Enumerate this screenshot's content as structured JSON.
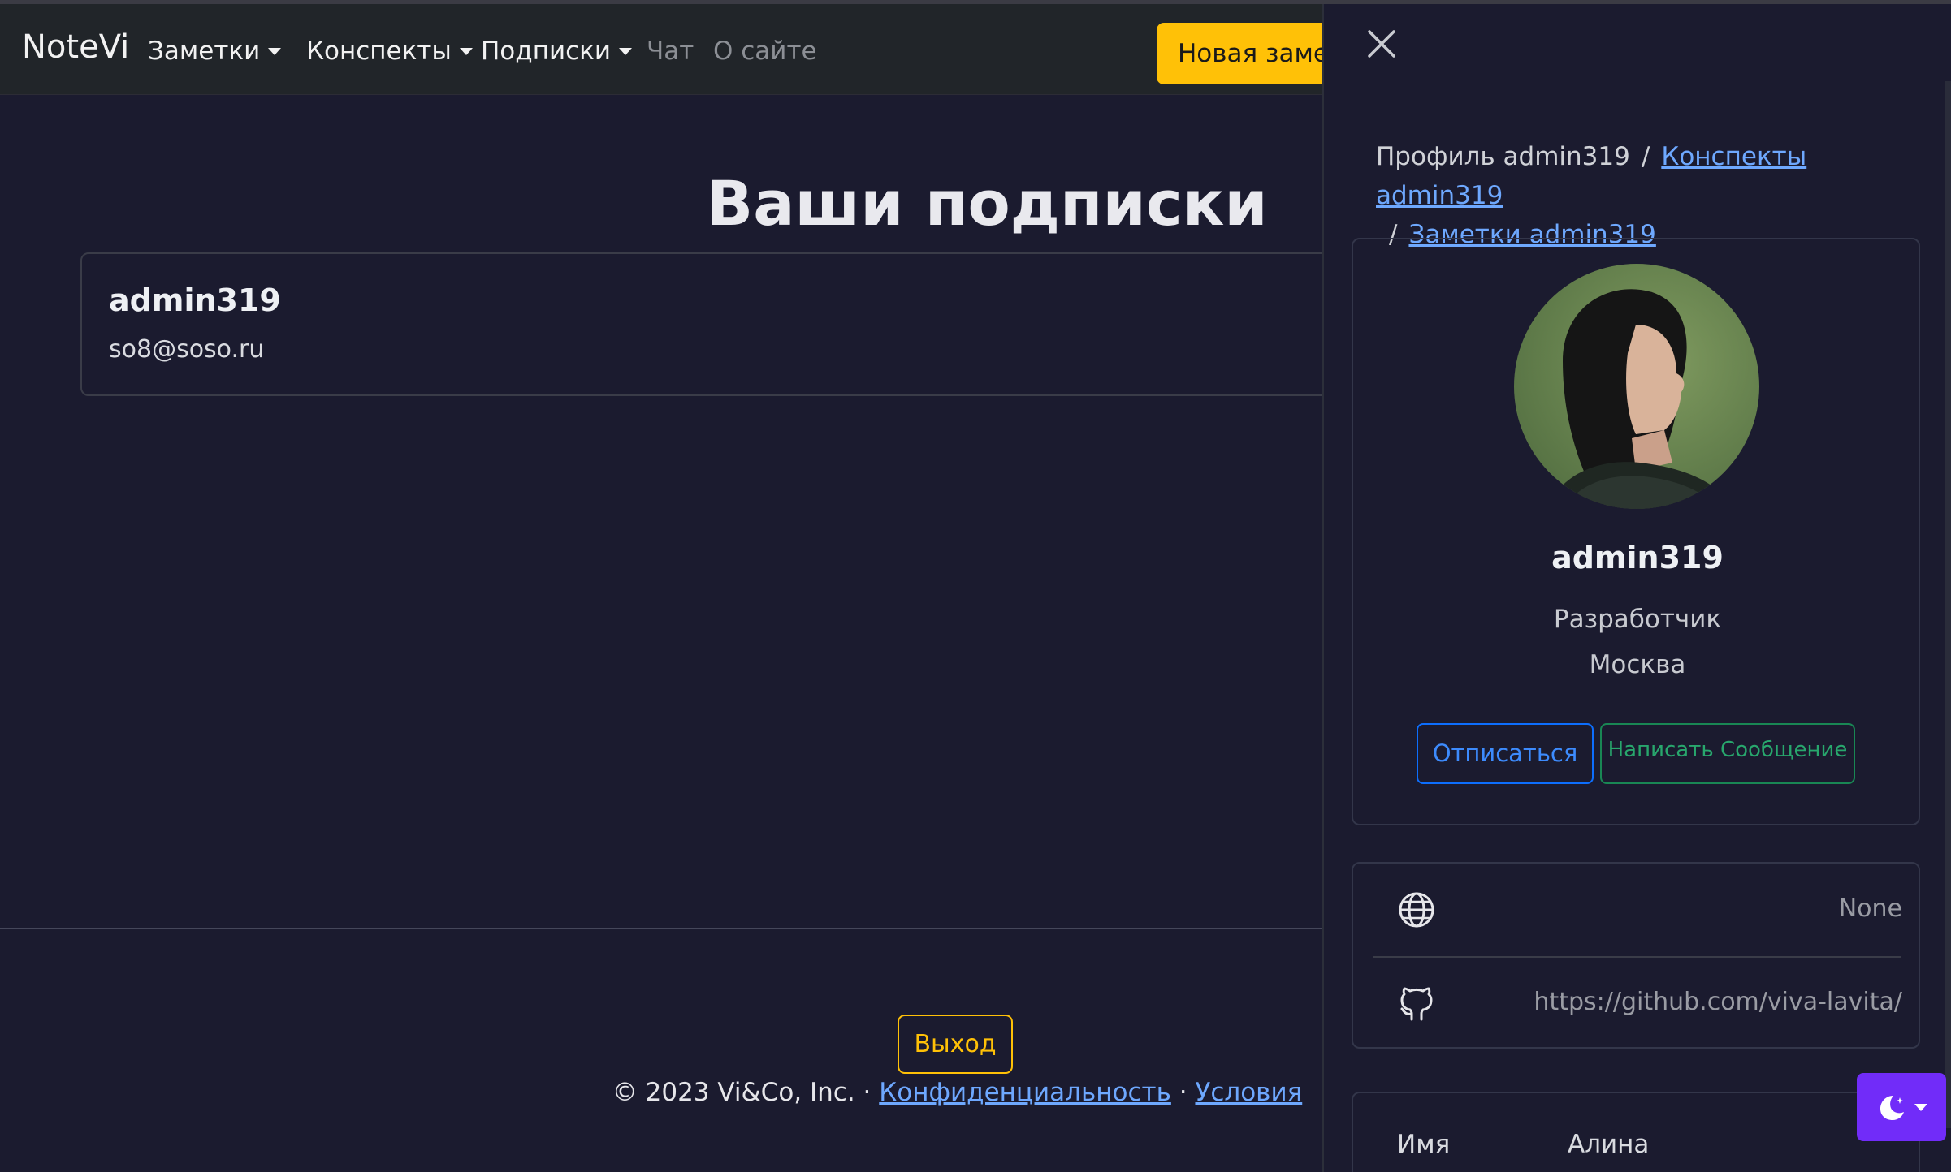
{
  "navbar": {
    "brand": "NoteVi",
    "items": [
      {
        "label": "Заметки",
        "dropdown": true
      },
      {
        "label": "Конспекты",
        "dropdown": true
      },
      {
        "label": "Подписки",
        "dropdown": true
      },
      {
        "label": "Чат",
        "dropdown": false
      },
      {
        "label": "О сайте",
        "dropdown": false
      }
    ],
    "new_note_label": "Новая заметка"
  },
  "main": {
    "title": "Ваши подписки",
    "subscriptions": [
      {
        "name": "admin319",
        "email": "so8@soso.ru"
      }
    ]
  },
  "footer": {
    "logout_label": "Выход",
    "copyright": "© 2023 Vi&Co, Inc. ·",
    "privacy_label": "Конфиденциальность",
    "dot": "·",
    "terms_label": "Условия"
  },
  "profile": {
    "breadcrumb_current": "Профиль admin319",
    "breadcrumb_sep": "/",
    "breadcrumb_conspects": "Конспекты admin319",
    "breadcrumb_notes": "Заметки admin319",
    "username": "admin319",
    "role": "Разработчик",
    "city": "Москва",
    "unsubscribe_label": "Отписаться",
    "message_label": "Написать Сообщение",
    "website_icon": "globe-icon",
    "website_value": "None",
    "github_icon": "github-icon",
    "github_value": "https://github.com/viva-lavita/",
    "name_label": "Имя",
    "name_value": "Алина"
  },
  "colors": {
    "background": "#1b1b2f",
    "navbar": "#212529",
    "warning": "#ffc107",
    "primary": "#0d6efd",
    "success": "#198754",
    "link": "#6ea8fe",
    "theme_button": "#712cf9"
  },
  "theme_toggle_icon": "moon-stars-icon"
}
